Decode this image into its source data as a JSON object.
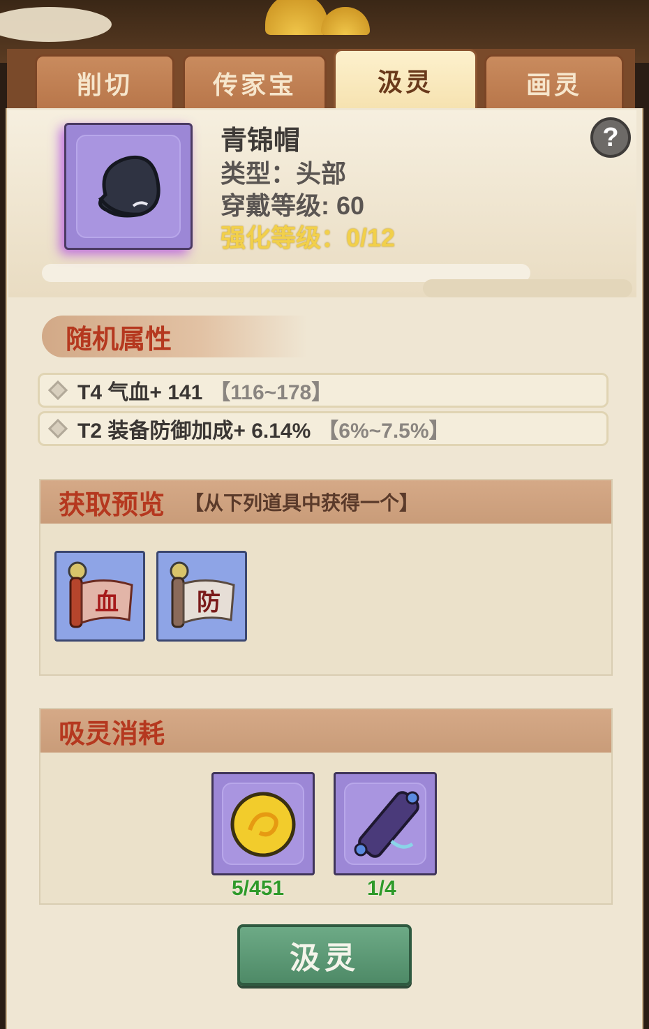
{
  "tabs": [
    {
      "label": "削切",
      "active": false
    },
    {
      "label": "传家宝",
      "active": false
    },
    {
      "label": "汲灵",
      "active": true
    },
    {
      "label": "画灵",
      "active": false
    }
  ],
  "item": {
    "name": "青锦帽",
    "type_line": "类型：头部",
    "level_line": "穿戴等级: 60",
    "enhance_line": "强化等级：0/12",
    "icon": "black-cap-icon"
  },
  "help": {
    "label": "?"
  },
  "random_attrs": {
    "title": "随机属性",
    "rows": [
      {
        "text": "T4 气血+ 141",
        "range": "【116~178】"
      },
      {
        "text": "T2 装备防御加成+ 6.14%",
        "range": "【6%~7.5%】"
      }
    ]
  },
  "preview": {
    "title": "获取预览",
    "subtitle": "【从下列道具中获得一个】",
    "items": [
      {
        "char": "血",
        "icon": "blood-scroll-icon"
      },
      {
        "char": "防",
        "icon": "defense-scroll-icon"
      }
    ]
  },
  "cost": {
    "title": "吸灵消耗",
    "items": [
      {
        "icon": "gold-orb-icon",
        "count": "5/451"
      },
      {
        "icon": "ornate-scroll-icon",
        "count": "1/4"
      }
    ]
  },
  "action_button": {
    "label": "汲灵"
  },
  "colors": {
    "accent_red": "#b5381f",
    "gold": "#f2d04a",
    "green": "#2f9a2a",
    "button": "#5a9a74"
  }
}
